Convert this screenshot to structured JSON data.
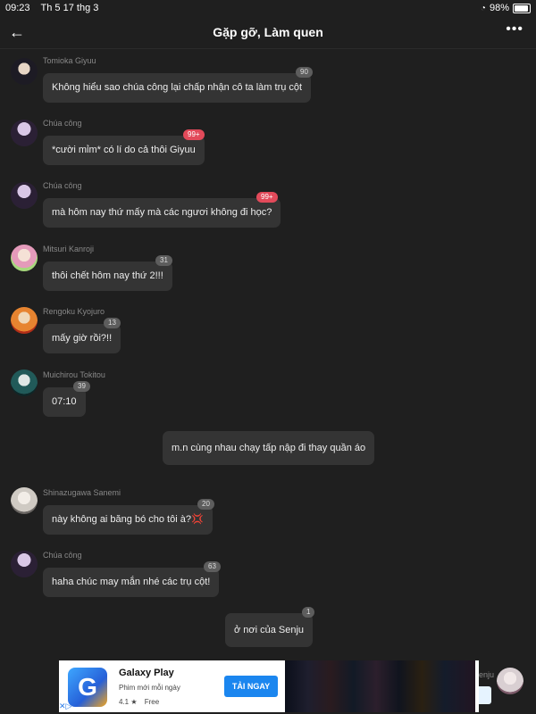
{
  "status_bar": {
    "time": "09:23",
    "date": "Th 5 17 thg 3",
    "battery": "98%"
  },
  "header": {
    "title": "Gặp gỡ, Làm quen"
  },
  "messages": [
    {
      "user": "Tomioka Giyuu",
      "text": "Không hiểu sao chúa công lại chấp nhận cô ta làm trụ cột",
      "count": "90",
      "red": false
    },
    {
      "user": "Chúa công",
      "text": "*cười mỉm* có lí do cả thôi Giyuu",
      "count": "99+",
      "red": true
    },
    {
      "user": "Chúa công",
      "text": "mà hôm nay thứ mấy mà các ngươi không đi học?",
      "count": "99+",
      "red": true
    },
    {
      "user": "Mitsuri Kanroji",
      "text": "thôi chết hôm nay thứ 2!!!",
      "count": "31",
      "red": false
    },
    {
      "user": "Rengoku Kyojuro",
      "text": "mấy giờ rồi?!!",
      "count": "13",
      "red": false
    },
    {
      "user": "Muichirou Tokitou",
      "text": "07:10",
      "count": "39",
      "red": false
    },
    {
      "user": "",
      "text": "m.n cùng nhau chạy tấp nập đi thay quần áo",
      "count": "",
      "red": false
    },
    {
      "user": "Shinazugawa Sanemi",
      "text": "này không ai băng bó cho tôi à?💢",
      "count": "20",
      "red": false
    },
    {
      "user": "Chúa công",
      "text": "haha chúc may mắn nhé các trụ cột!",
      "count": "63",
      "red": false
    },
    {
      "user": "",
      "text": "ở nơi của Senju",
      "count": "1",
      "red": false
    }
  ],
  "partial": {
    "left_text": "",
    "right_user": "enju"
  },
  "ad": {
    "title": "Galaxy Play",
    "subtitle": "Phim mới mỗi ngày",
    "rating": "4.1 ★",
    "price": "Free",
    "cta": "TẢI NGAY",
    "logo_letter": "G"
  }
}
